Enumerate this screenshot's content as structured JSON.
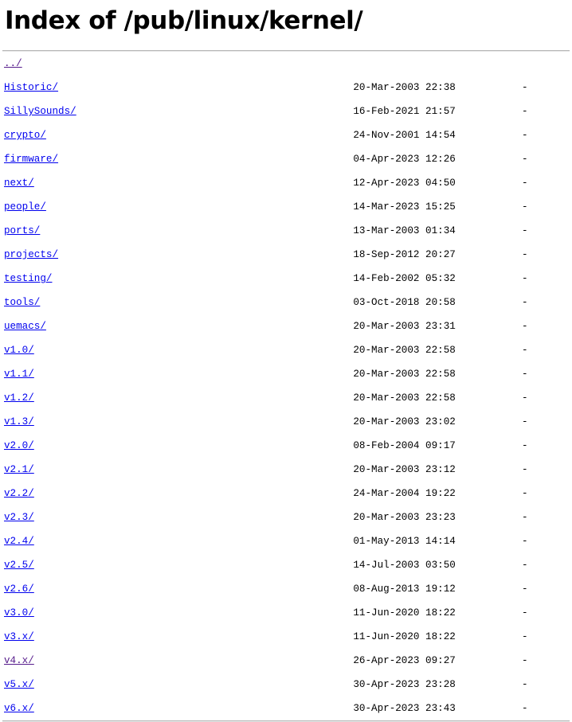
{
  "page": {
    "title": "Index of /pub/linux/kernel/",
    "size_placeholder": "-"
  },
  "colors": {
    "link": "#0000ee",
    "visited_link": "#551a8b",
    "text": "#000000",
    "background": "#ffffff",
    "rule": "#b5b5b5"
  },
  "listing": {
    "entries": [
      {
        "name": "../",
        "date": "",
        "size": "",
        "visited": true
      },
      {
        "name": "Historic/",
        "date": "20-Mar-2003 22:38",
        "size": "-",
        "visited": false
      },
      {
        "name": "SillySounds/",
        "date": "16-Feb-2021 21:57",
        "size": "-",
        "visited": false
      },
      {
        "name": "crypto/",
        "date": "24-Nov-2001 14:54",
        "size": "-",
        "visited": false
      },
      {
        "name": "firmware/",
        "date": "04-Apr-2023 12:26",
        "size": "-",
        "visited": false
      },
      {
        "name": "next/",
        "date": "12-Apr-2023 04:50",
        "size": "-",
        "visited": false
      },
      {
        "name": "people/",
        "date": "14-Mar-2023 15:25",
        "size": "-",
        "visited": false
      },
      {
        "name": "ports/",
        "date": "13-Mar-2003 01:34",
        "size": "-",
        "visited": false
      },
      {
        "name": "projects/",
        "date": "18-Sep-2012 20:27",
        "size": "-",
        "visited": false
      },
      {
        "name": "testing/",
        "date": "14-Feb-2002 05:32",
        "size": "-",
        "visited": false
      },
      {
        "name": "tools/",
        "date": "03-Oct-2018 20:58",
        "size": "-",
        "visited": false
      },
      {
        "name": "uemacs/",
        "date": "20-Mar-2003 23:31",
        "size": "-",
        "visited": false
      },
      {
        "name": "v1.0/",
        "date": "20-Mar-2003 22:58",
        "size": "-",
        "visited": false
      },
      {
        "name": "v1.1/",
        "date": "20-Mar-2003 22:58",
        "size": "-",
        "visited": false
      },
      {
        "name": "v1.2/",
        "date": "20-Mar-2003 22:58",
        "size": "-",
        "visited": false
      },
      {
        "name": "v1.3/",
        "date": "20-Mar-2003 23:02",
        "size": "-",
        "visited": false
      },
      {
        "name": "v2.0/",
        "date": "08-Feb-2004 09:17",
        "size": "-",
        "visited": false
      },
      {
        "name": "v2.1/",
        "date": "20-Mar-2003 23:12",
        "size": "-",
        "visited": false
      },
      {
        "name": "v2.2/",
        "date": "24-Mar-2004 19:22",
        "size": "-",
        "visited": false
      },
      {
        "name": "v2.3/",
        "date": "20-Mar-2003 23:23",
        "size": "-",
        "visited": false
      },
      {
        "name": "v2.4/",
        "date": "01-May-2013 14:14",
        "size": "-",
        "visited": false
      },
      {
        "name": "v2.5/",
        "date": "14-Jul-2003 03:50",
        "size": "-",
        "visited": false
      },
      {
        "name": "v2.6/",
        "date": "08-Aug-2013 19:12",
        "size": "-",
        "visited": false
      },
      {
        "name": "v3.0/",
        "date": "11-Jun-2020 18:22",
        "size": "-",
        "visited": false
      },
      {
        "name": "v3.x/",
        "date": "11-Jun-2020 18:22",
        "size": "-",
        "visited": false
      },
      {
        "name": "v4.x/",
        "date": "26-Apr-2023 09:27",
        "size": "-",
        "visited": true
      },
      {
        "name": "v5.x/",
        "date": "30-Apr-2023 23:28",
        "size": "-",
        "visited": false
      },
      {
        "name": "v6.x/",
        "date": "30-Apr-2023 23:43",
        "size": "-",
        "visited": false
      }
    ],
    "layout": {
      "name_column_width": 51,
      "date_column_start": 58,
      "size_column_start": 86
    }
  }
}
